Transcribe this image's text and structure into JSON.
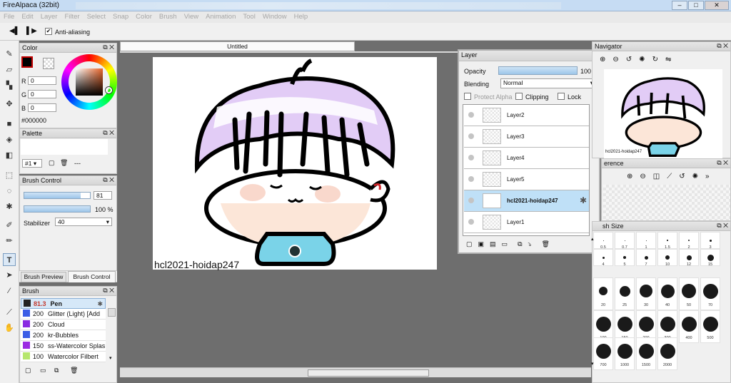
{
  "window": {
    "title": "FireAlpaca (32bit)",
    "min": "–",
    "max": "□",
    "close": "✕"
  },
  "menu": [
    "File",
    "Edit",
    "Layer",
    "Filter",
    "Select",
    "Snap",
    "Color",
    "Brush",
    "View",
    "Animation",
    "Tool",
    "Window",
    "Help"
  ],
  "toolbar": {
    "anti_aliasing": "Anti-aliasing",
    "anti_aliasing_checked": true
  },
  "canvas": {
    "tab_title": "Untitled",
    "watermark": "hcl2021-hoidap247"
  },
  "color_panel": {
    "title": "Color",
    "r_label": "R",
    "r": "0",
    "g_label": "G",
    "g": "0",
    "b_label": "B",
    "b": "0",
    "hex": "#000000",
    "foreground": "#000000"
  },
  "palette_panel": {
    "title": "Palette",
    "selector": "#1",
    "dash": "---"
  },
  "brush_control": {
    "title": "Brush Control",
    "size": "81",
    "opacity": "100 %",
    "opacity_value": 100,
    "size_fill": 0.86,
    "stabilizer_label": "Stabilizer",
    "stabilizer": "40"
  },
  "tabs": {
    "preview": "Brush Preview",
    "control": "Brush Control"
  },
  "brush_panel": {
    "title": "Brush",
    "items": [
      {
        "size": "81.3",
        "name": "Pen",
        "color": "#222222"
      },
      {
        "size": "200",
        "name": "Glitter (Light) [Add",
        "color": "#3c5ee6"
      },
      {
        "size": "200",
        "name": "Cloud",
        "color": "#8a2be2"
      },
      {
        "size": "200",
        "name": "kr-Bubbles",
        "color": "#3c5ee6"
      },
      {
        "size": "150",
        "name": "ss-Watercolor Splas",
        "color": "#9b2be2"
      },
      {
        "size": "100",
        "name": "Watercolor Filbert",
        "color": "#b6e66e"
      }
    ]
  },
  "layer_panel": {
    "title": "Layer",
    "opacity_label": "Opacity",
    "opacity": "100 %",
    "opacity_value": 100,
    "blending_label": "Blending",
    "blending": "Normal",
    "protect_alpha": "Protect Alpha",
    "clipping": "Clipping",
    "lock": "Lock",
    "layers": [
      "Layer2",
      "Layer3",
      "Layer4",
      "Layer5",
      "hcl2021-hoidap247",
      "Layer1"
    ]
  },
  "navigator": {
    "title": "Navigator",
    "caption": "hcl2021-hoidap247"
  },
  "reference": {
    "title": "erence"
  },
  "brush_size": {
    "title": "sh Size",
    "sizes": [
      "0.5",
      "0.7",
      "1",
      "1.5",
      "2",
      "3",
      "4",
      "5",
      "7",
      "10",
      "12",
      "15",
      "20",
      "25",
      "30",
      "40",
      "50",
      "70",
      "100",
      "150",
      "200",
      "300",
      "400",
      "500",
      "700",
      "1000",
      "1500",
      "2000"
    ]
  }
}
